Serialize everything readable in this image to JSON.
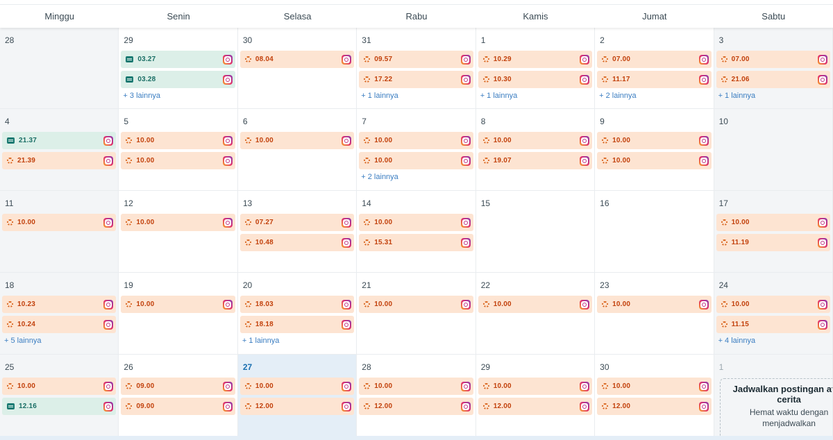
{
  "weekdays": [
    "Minggu",
    "Senin",
    "Selasa",
    "Rabu",
    "Kamis",
    "Jumat",
    "Sabtu"
  ],
  "weeks": [
    [
      {
        "day": "28",
        "faded": false,
        "events": [],
        "more": ""
      },
      {
        "day": "29",
        "events": [
          {
            "time": "03.27",
            "kind": "post"
          },
          {
            "time": "03.28",
            "kind": "post"
          }
        ],
        "more": "+ 3 lainnya"
      },
      {
        "day": "30",
        "events": [
          {
            "time": "08.04",
            "kind": "pending"
          }
        ],
        "more": ""
      },
      {
        "day": "31",
        "events": [
          {
            "time": "09.57",
            "kind": "pending"
          },
          {
            "time": "17.22",
            "kind": "pending"
          }
        ],
        "more": "+ 1 lainnya"
      },
      {
        "day": "1",
        "events": [
          {
            "time": "10.29",
            "kind": "pending"
          },
          {
            "time": "10.30",
            "kind": "pending"
          }
        ],
        "more": "+ 1 lainnya"
      },
      {
        "day": "2",
        "events": [
          {
            "time": "07.00",
            "kind": "pending"
          },
          {
            "time": "11.17",
            "kind": "pending"
          }
        ],
        "more": "+ 2 lainnya"
      },
      {
        "day": "3",
        "events": [
          {
            "time": "07.00",
            "kind": "pending"
          },
          {
            "time": "21.06",
            "kind": "pending"
          }
        ],
        "more": "+ 1 lainnya"
      }
    ],
    [
      {
        "day": "4",
        "events": [
          {
            "time": "21.37",
            "kind": "post"
          },
          {
            "time": "21.39",
            "kind": "pending"
          }
        ],
        "more": ""
      },
      {
        "day": "5",
        "events": [
          {
            "time": "10.00",
            "kind": "pending"
          },
          {
            "time": "10.00",
            "kind": "pending"
          }
        ],
        "more": ""
      },
      {
        "day": "6",
        "events": [
          {
            "time": "10.00",
            "kind": "pending"
          }
        ],
        "more": ""
      },
      {
        "day": "7",
        "events": [
          {
            "time": "10.00",
            "kind": "pending"
          },
          {
            "time": "10.00",
            "kind": "pending"
          }
        ],
        "more": "+ 2 lainnya"
      },
      {
        "day": "8",
        "events": [
          {
            "time": "10.00",
            "kind": "pending"
          },
          {
            "time": "19.07",
            "kind": "pending"
          }
        ],
        "more": ""
      },
      {
        "day": "9",
        "events": [
          {
            "time": "10.00",
            "kind": "pending"
          },
          {
            "time": "10.00",
            "kind": "pending"
          }
        ],
        "more": ""
      },
      {
        "day": "10",
        "events": [],
        "more": ""
      }
    ],
    [
      {
        "day": "11",
        "events": [
          {
            "time": "10.00",
            "kind": "pending"
          }
        ],
        "more": ""
      },
      {
        "day": "12",
        "events": [
          {
            "time": "10.00",
            "kind": "pending"
          }
        ],
        "more": ""
      },
      {
        "day": "13",
        "events": [
          {
            "time": "07.27",
            "kind": "pending"
          },
          {
            "time": "10.48",
            "kind": "pending"
          }
        ],
        "more": ""
      },
      {
        "day": "14",
        "events": [
          {
            "time": "10.00",
            "kind": "pending"
          },
          {
            "time": "15.31",
            "kind": "pending"
          }
        ],
        "more": ""
      },
      {
        "day": "15",
        "events": [],
        "more": ""
      },
      {
        "day": "16",
        "events": [],
        "more": ""
      },
      {
        "day": "17",
        "events": [
          {
            "time": "10.00",
            "kind": "pending"
          },
          {
            "time": "11.19",
            "kind": "pending"
          }
        ],
        "more": ""
      }
    ],
    [
      {
        "day": "18",
        "events": [
          {
            "time": "10.23",
            "kind": "pending"
          },
          {
            "time": "10.24",
            "kind": "pending"
          }
        ],
        "more": "+ 5 lainnya"
      },
      {
        "day": "19",
        "events": [
          {
            "time": "10.00",
            "kind": "pending"
          }
        ],
        "more": ""
      },
      {
        "day": "20",
        "events": [
          {
            "time": "18.03",
            "kind": "pending"
          },
          {
            "time": "18.18",
            "kind": "pending"
          }
        ],
        "more": "+ 1 lainnya"
      },
      {
        "day": "21",
        "events": [
          {
            "time": "10.00",
            "kind": "pending"
          }
        ],
        "more": ""
      },
      {
        "day": "22",
        "events": [
          {
            "time": "10.00",
            "kind": "pending"
          }
        ],
        "more": ""
      },
      {
        "day": "23",
        "events": [
          {
            "time": "10.00",
            "kind": "pending"
          }
        ],
        "more": ""
      },
      {
        "day": "24",
        "events": [
          {
            "time": "10.00",
            "kind": "pending"
          },
          {
            "time": "11.15",
            "kind": "pending"
          }
        ],
        "more": "+ 4 lainnya"
      }
    ],
    [
      {
        "day": "25",
        "events": [
          {
            "time": "10.00",
            "kind": "pending"
          },
          {
            "time": "12.16",
            "kind": "post"
          }
        ],
        "more": ""
      },
      {
        "day": "26",
        "events": [
          {
            "time": "09.00",
            "kind": "pending"
          },
          {
            "time": "09.00",
            "kind": "pending"
          }
        ],
        "more": ""
      },
      {
        "day": "27",
        "today": true,
        "events": [
          {
            "time": "10.00",
            "kind": "pending"
          },
          {
            "time": "12.00",
            "kind": "pending"
          }
        ],
        "more": ""
      },
      {
        "day": "28",
        "events": [
          {
            "time": "10.00",
            "kind": "pending"
          },
          {
            "time": "12.00",
            "kind": "pending"
          }
        ],
        "more": ""
      },
      {
        "day": "29",
        "events": [
          {
            "time": "10.00",
            "kind": "pending"
          },
          {
            "time": "12.00",
            "kind": "pending"
          }
        ],
        "more": ""
      },
      {
        "day": "30",
        "events": [
          {
            "time": "10.00",
            "kind": "pending"
          },
          {
            "time": "12.00",
            "kind": "pending"
          }
        ],
        "more": ""
      },
      {
        "day": "1",
        "faded": true,
        "events": [],
        "more": "",
        "promo": true
      }
    ]
  ],
  "promo": {
    "title": "Jadwalkan postingan atau cerita",
    "body": "Hemat waktu dengan menjadwalkan"
  },
  "colors": {
    "pending_bg": "#fde4d2",
    "pending_text": "#c2410c",
    "post_bg": "#dcefe8",
    "post_text": "#1a6e65",
    "today_bg": "#e4eef7",
    "weekend_bg": "#f3f5f7",
    "link": "#3a7dc1"
  },
  "icons": {
    "pending": "pending-status-icon",
    "post": "published-post-icon",
    "platform": "instagram-icon"
  }
}
